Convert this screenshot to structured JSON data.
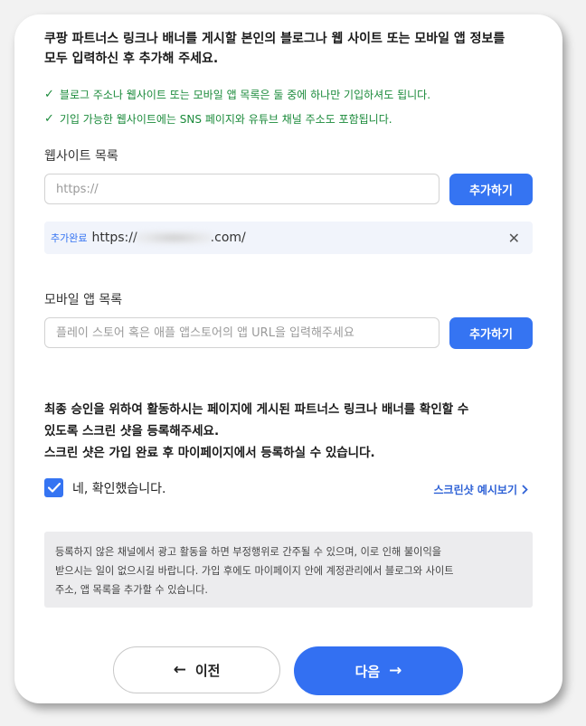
{
  "intro": {
    "line1": "쿠팡 파트너스 링크나 배너를 게시할 본인의 블로그나 웹 사이트 또는 모바일 앱 정보를",
    "line2": "모두 입력하신 후 추가해 주세요."
  },
  "tips": [
    {
      "icon": "checkmark-icon",
      "text": "블로그 주소나 웹사이트 또는 모바일 앱 목록은 둘 중에 하나만 기입하셔도 됩니다."
    },
    {
      "icon": "checkmark-icon",
      "text": "기입 가능한 웹사이트에는 SNS 페이지와 유튜브 채널 주소도 포함됩니다."
    }
  ],
  "website": {
    "label": "웹사이트 목록",
    "placeholder": "https://",
    "add_button": "추가하기",
    "added": {
      "tag": "추가완료",
      "url_prefix": "https://",
      "url_suffix": ".com/",
      "remove_icon": "close-icon"
    }
  },
  "mobile": {
    "label": "모바일 앱 목록",
    "placeholder": "플레이 스토어 혹은 애플 앱스토어의 앱 URL을 입력해주세요",
    "add_button": "추가하기"
  },
  "notice": {
    "line1": "최종 승인을 위하여 활동하시는 페이지에 게시된 파트너스 링크나 배너를 확인할 수",
    "line2": "있도록 스크린 샷을 등록해주세요.",
    "line3": "스크린 샷은 가입 완료 후 마이페이지에서 등록하실 수 있습니다."
  },
  "confirm": {
    "label": "네, 확인했습니다.",
    "checked": true
  },
  "preview_link": "스크린샷 예시보기",
  "info": {
    "line1": "등록하지 않은 채널에서 광고 활동을 하면 부정행위로 간주될 수 있으며, 이로 인해 불이익을",
    "line2": "받으시는 일이 없으시길 바랍니다. 가입 후에도 마이페이지 안에 계정관리에서 블로그와 사이트",
    "line3": "주소, 앱 목록을 추가할 수 있습니다."
  },
  "buttons": {
    "prev": "이전",
    "next": "다음"
  },
  "colors": {
    "primary": "#3574f2",
    "success": "#1a8a3a",
    "info_bg": "#ececee"
  }
}
